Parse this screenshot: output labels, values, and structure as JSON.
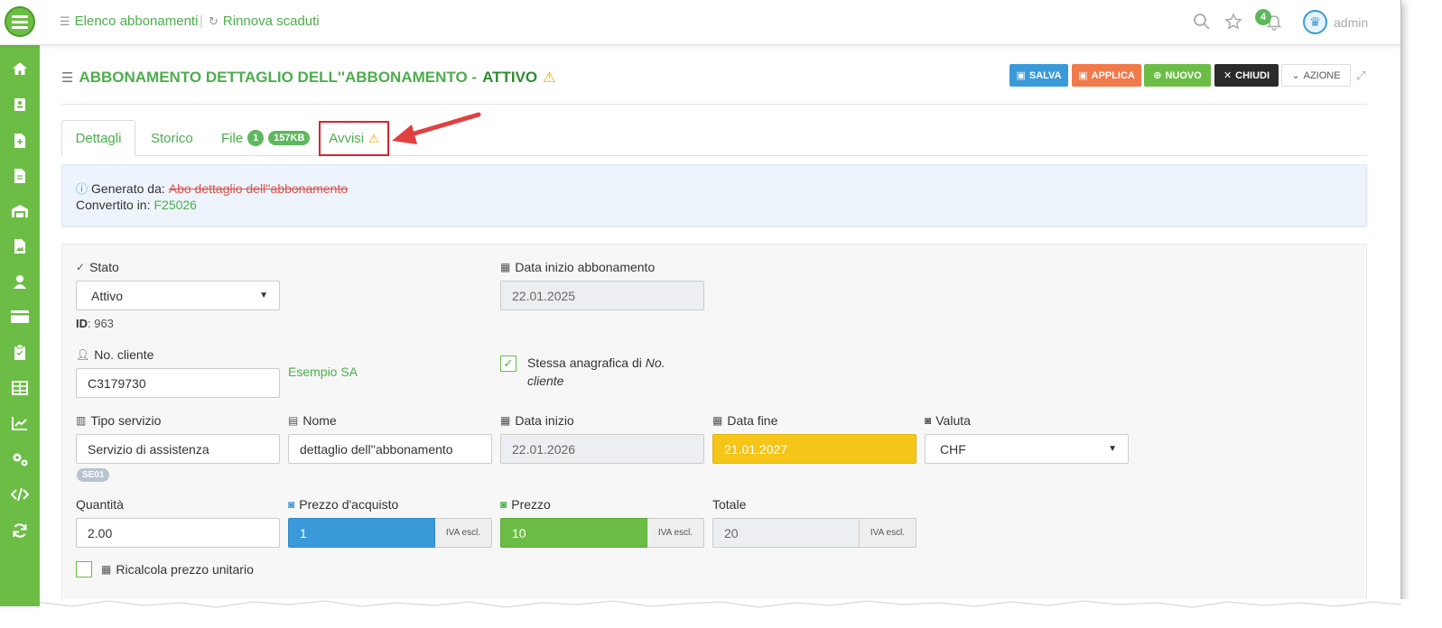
{
  "topbar": {
    "link_list": "Elenco abbonamenti",
    "link_renew": "Rinnova scaduti",
    "notifications_count": "4",
    "username": "admin"
  },
  "header": {
    "title": "ABBONAMENTO DETTAGLIO DELL''ABBONAMENTO -",
    "status": "ATTIVO",
    "buttons": {
      "salva": "SALVA",
      "applica": "APPLICA",
      "nuovo": "NUOVO",
      "chiudi": "CHIUDI",
      "azione": "AZIONE"
    }
  },
  "tabs": {
    "dettagli": "Dettagli",
    "storico": "Storico",
    "file": "File",
    "file_count": "1",
    "file_size": "157KB",
    "avvisi": "Avvisi"
  },
  "info": {
    "generated_label": "Generato da:",
    "generated_value": "Abo dettaglio dell''abbonamento",
    "converted_label": "Convertito in:",
    "converted_value": "F25026"
  },
  "form": {
    "stato_label": "Stato",
    "stato_value": "Attivo",
    "id_label": "ID",
    "id_value": ": 963",
    "data_inizio_abbonamento_label": "Data inizio abbonamento",
    "data_inizio_abbonamento_value": "22.01.2025",
    "cliente_label": "No. cliente",
    "cliente_value": "C3179730",
    "cliente_name": "Esempio SA",
    "stessa_anagrafica_text": "Stessa anagrafica di ",
    "stessa_anagrafica_ref": "No. cliente",
    "tipo_servizio_label": "Tipo servizio",
    "tipo_servizio_value": "Servizio di assistenza",
    "tipo_servizio_code": "SE01",
    "nome_label": "Nome",
    "nome_value": "dettaglio dell''abbonamento",
    "data_inizio_label": "Data inizio",
    "data_inizio_value": "22.01.2026",
    "data_fine_label": "Data fine",
    "data_fine_value": "21.01.2027",
    "valuta_label": "Valuta",
    "valuta_value": "CHF",
    "quantita_label": "Quantità",
    "quantita_value": "2.00",
    "prezzo_acquisto_label": "Prezzo d'acquisto",
    "prezzo_acquisto_value": "1",
    "prezzo_label": "Prezzo",
    "prezzo_value": "10",
    "totale_label": "Totale",
    "totale_value": "20",
    "iva_addon": "IVA escl.",
    "ricalcola_label": "Ricalcola prezzo unitario"
  },
  "colors": {
    "brand_green": "#6cbd45",
    "blue": "#3a9ad9",
    "orange": "#f07a4a",
    "dark": "#2b2b2b",
    "yellow": "#f5c518",
    "highlight_red": "#d9232e"
  }
}
